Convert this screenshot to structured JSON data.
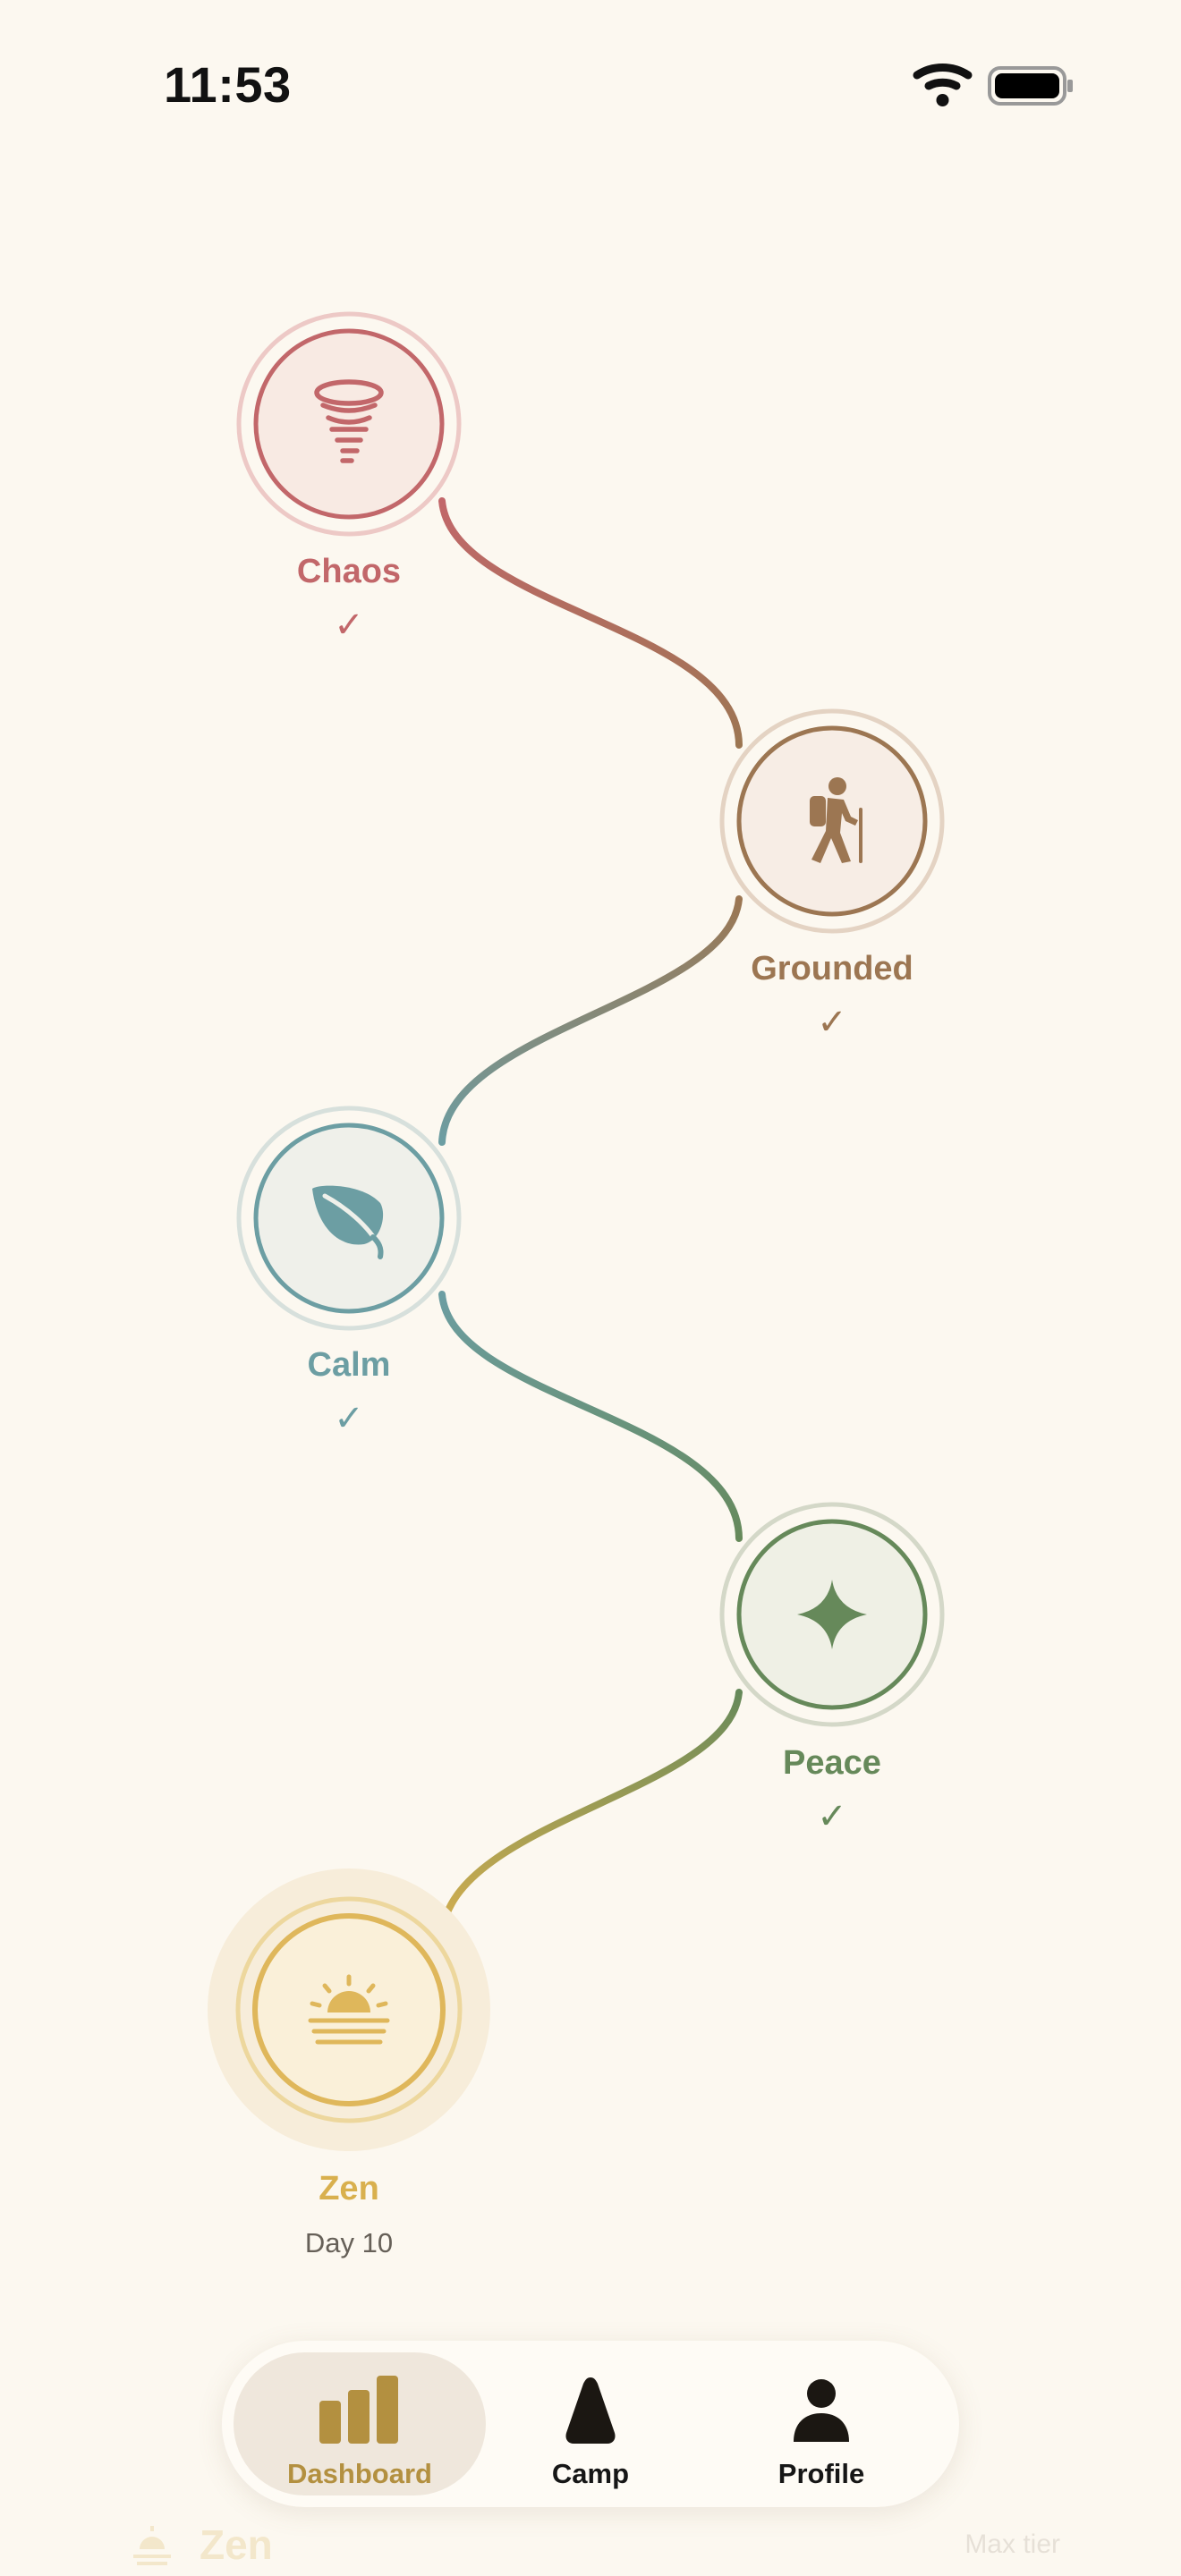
{
  "status_bar": {
    "time": "11:53"
  },
  "journey": {
    "stages": [
      {
        "name": "Chaos",
        "icon": "tornado-icon",
        "color": "#C2676A",
        "status_mark": "✓"
      },
      {
        "name": "Grounded",
        "icon": "hiker-icon",
        "color": "#9C7652",
        "status_mark": "✓"
      },
      {
        "name": "Calm",
        "icon": "leaf-icon",
        "color": "#6C9EA3",
        "status_mark": "✓"
      },
      {
        "name": "Peace",
        "icon": "sparkle-icon",
        "color": "#66895A",
        "status_mark": "✓"
      },
      {
        "name": "Zen",
        "icon": "sunrise-icon",
        "color": "#D9B04E",
        "status_mark": "Day 10",
        "current": true
      }
    ]
  },
  "tab_bar": {
    "tabs": [
      {
        "label": "Dashboard",
        "icon": "bar-chart-icon",
        "active": true
      },
      {
        "label": "Camp",
        "icon": "tent-icon",
        "active": false
      },
      {
        "label": "Profile",
        "icon": "person-icon",
        "active": false
      }
    ]
  },
  "bottom_card_peek": {
    "title": "Zen",
    "meta": "Max tier",
    "icon": "sunrise-icon"
  }
}
